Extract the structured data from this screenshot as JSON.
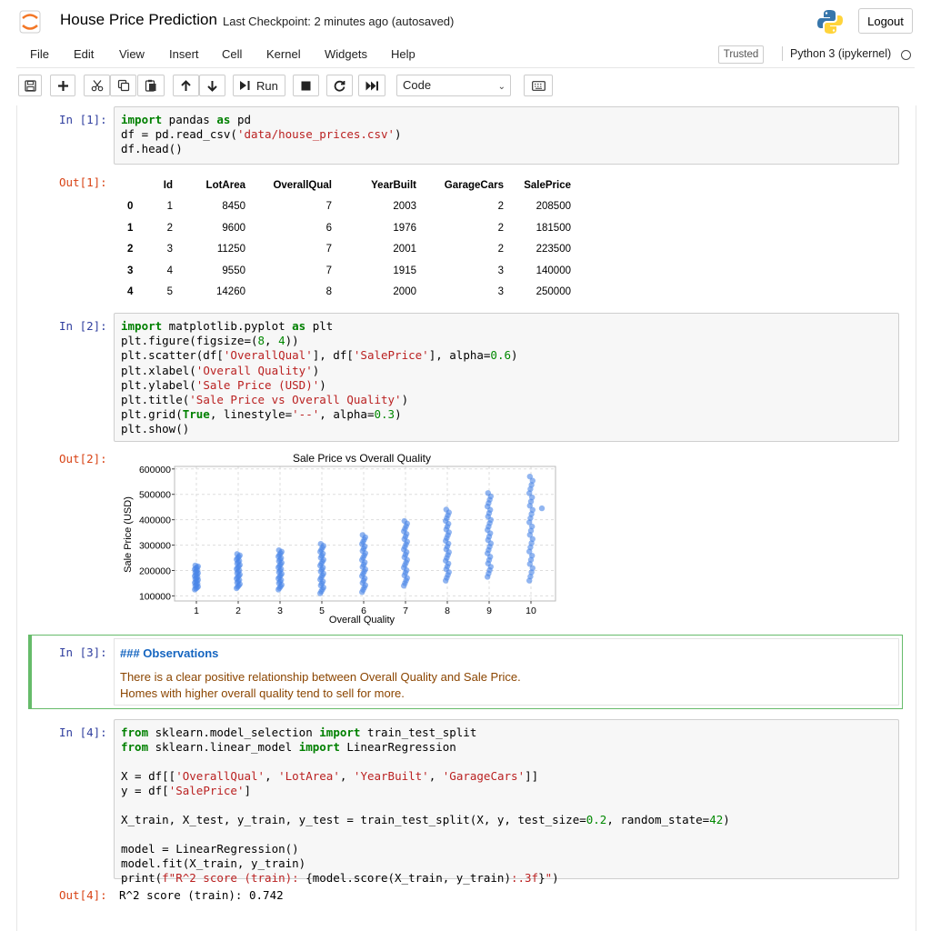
{
  "header": {
    "title": "House Price Prediction",
    "checkpoint": "Last Checkpoint: 2 minutes ago  (autosaved)",
    "logout_label": "Logout"
  },
  "menubar": {
    "items": [
      "File",
      "Edit",
      "View",
      "Insert",
      "Cell",
      "Kernel",
      "Widgets",
      "Help"
    ],
    "trusted_label": "Trusted",
    "kernel_name": "Python 3 (ipykernel)"
  },
  "toolbar": {
    "run_label": "Run",
    "cell_type": "Code",
    "icons": [
      "save-icon",
      "plus-icon",
      "scissors-icon",
      "copy-icon",
      "paste-icon",
      "arrow-up-icon",
      "arrow-down-icon",
      "run-icon",
      "stop-icon",
      "restart-icon",
      "fast-forward-icon",
      "keyboard-icon"
    ]
  },
  "cells": {
    "c1": {
      "in_prompt": "In [1]:",
      "out_prompt": "Out[1]:",
      "table": {
        "columns": [
          "",
          "Id",
          "LotArea",
          "OverallQual",
          "YearBuilt",
          "GarageCars",
          "SalePrice"
        ],
        "rows": [
          [
            "0",
            "1",
            "8450",
            "7",
            "2003",
            "2",
            "208500"
          ],
          [
            "1",
            "2",
            "9600",
            "6",
            "1976",
            "2",
            "181500"
          ],
          [
            "2",
            "3",
            "11250",
            "7",
            "2001",
            "2",
            "223500"
          ],
          [
            "3",
            "4",
            "9550",
            "7",
            "1915",
            "3",
            "140000"
          ],
          [
            "4",
            "5",
            "14260",
            "8",
            "2000",
            "3",
            "250000"
          ]
        ]
      }
    },
    "c2": {
      "in_prompt": "In [2]:",
      "out_prompt": "Out[2]:"
    },
    "c3": {
      "in_prompt": "In [3]:",
      "heading": "### Observations",
      "line1": "There is a clear positive relationship between Overall Quality and Sale Price.",
      "line2": "Homes with higher overall quality tend to sell for more."
    },
    "c4": {
      "in_prompt": "In [4]:",
      "out_prompt": "Out[4]:",
      "output": "R^2 score (train): 0.742"
    }
  },
  "colors": {
    "point": "#4a86e8",
    "md_border": "#66bb6a",
    "in_prompt": "#303f9f",
    "out_prompt": "#d84315"
  },
  "chart_data": {
    "type": "scatter",
    "title": "Sale Price vs Overall Quality",
    "xlabel": "Overall Quality",
    "ylabel": "Sale Price (USD)",
    "xticks": [
      "1",
      "2",
      "3",
      "5",
      "6",
      "7",
      "8",
      "9",
      "10"
    ],
    "yticks": [
      "100000",
      "200000",
      "300000",
      "400000",
      "500000",
      "600000"
    ],
    "ylim": [
      80000,
      610000
    ],
    "grid": true,
    "columns": [
      {
        "x": "1",
        "min": 125000,
        "max": 220000
      },
      {
        "x": "2",
        "min": 130000,
        "max": 265000
      },
      {
        "x": "3",
        "min": 125000,
        "max": 280000
      },
      {
        "x": "5",
        "min": 110000,
        "max": 305000
      },
      {
        "x": "6",
        "min": 115000,
        "max": 340000
      },
      {
        "x": "7",
        "min": 140000,
        "max": 395000
      },
      {
        "x": "8",
        "min": 160000,
        "max": 440000
      },
      {
        "x": "9",
        "min": 175000,
        "max": 505000
      },
      {
        "x": "10",
        "min": 160000,
        "max": 570000
      }
    ],
    "outliers": [
      {
        "x": "10+",
        "y": 445000
      }
    ]
  }
}
